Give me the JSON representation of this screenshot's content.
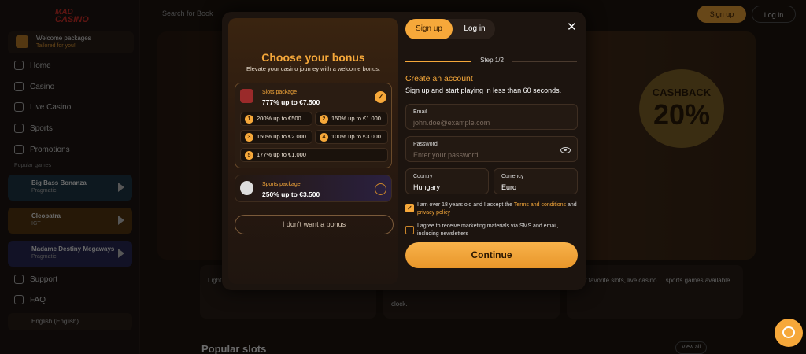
{
  "topbar": {
    "search_placeholder": "Search for Book",
    "signup": "Sign up",
    "login": "Log in"
  },
  "sidebar": {
    "logo_line1": "MAD",
    "logo_line2": "CASINO",
    "promo_title": "Welcome packages",
    "promo_sub": "Tailored for you!",
    "nav": [
      {
        "label": "Home",
        "icon": "home-icon"
      },
      {
        "label": "Casino",
        "icon": "casino-icon"
      },
      {
        "label": "Live Casino",
        "icon": "live-casino-icon"
      },
      {
        "label": "Sports",
        "icon": "sports-icon"
      },
      {
        "label": "Promotions",
        "icon": "promotions-icon"
      }
    ],
    "popular_games_label": "Popular games",
    "games": [
      {
        "name": "Big Bass Bonanza",
        "provider": "Pragmatic"
      },
      {
        "name": "Cleopatra",
        "provider": "IGT"
      },
      {
        "name": "Madame Destiny Megaways",
        "provider": "Pragmatic"
      }
    ],
    "support": "Support",
    "faq": "FAQ",
    "language": "English (English)"
  },
  "background": {
    "cashback_label": "CASHBACK",
    "cashback_value": "20%",
    "card1": "Light ... with ... methods.",
    "card2": "clock.",
    "card3": "your favorite slots, live casino ... sports games available.",
    "popular_slots": "Popular slots",
    "view_all": "View all"
  },
  "modal": {
    "title": "Choose your bonus",
    "subtitle": "Elevate your casino journey with a welcome bonus.",
    "slots_package": {
      "label": "Slots package",
      "value": "777% up to €7.500",
      "selected": true
    },
    "options": [
      {
        "num": "1",
        "text": "200% up to €500"
      },
      {
        "num": "2",
        "text": "150% up to €1.000"
      },
      {
        "num": "3",
        "text": "150% up to €2.000"
      },
      {
        "num": "4",
        "text": "100% up to €3.000"
      },
      {
        "num": "5",
        "text": "177% up to €1.000"
      }
    ],
    "sports_package": {
      "label": "Sports package",
      "value": "250% up to €3.500",
      "selected": false
    },
    "no_bonus": "I don't want a bonus",
    "tab_signup": "Sign up",
    "tab_login": "Log in",
    "close": "✕",
    "step": "Step 1/2",
    "create_title": "Create an account",
    "create_sub": "Sign up and start playing in less than 60 seconds.",
    "email_label": "Email",
    "email_placeholder": "john.doe@example.com",
    "password_label": "Password",
    "password_placeholder": "Enter your password",
    "country_label": "Country",
    "country_value": "Hungary",
    "currency_label": "Currency",
    "currency_value": "Euro",
    "consent1_pre": "I am over 18 years old and I accept the ",
    "consent1_link1": "Terms and conditions",
    "consent1_mid": " and ",
    "consent1_link2": "privacy policy",
    "consent1_checked": true,
    "consent2": "I agree to receive marketing materials via SMS and email, including newsletters",
    "consent2_checked": false,
    "continue": "Continue"
  },
  "colors": {
    "accent": "#f6a83a",
    "bg": "#1c140f"
  }
}
